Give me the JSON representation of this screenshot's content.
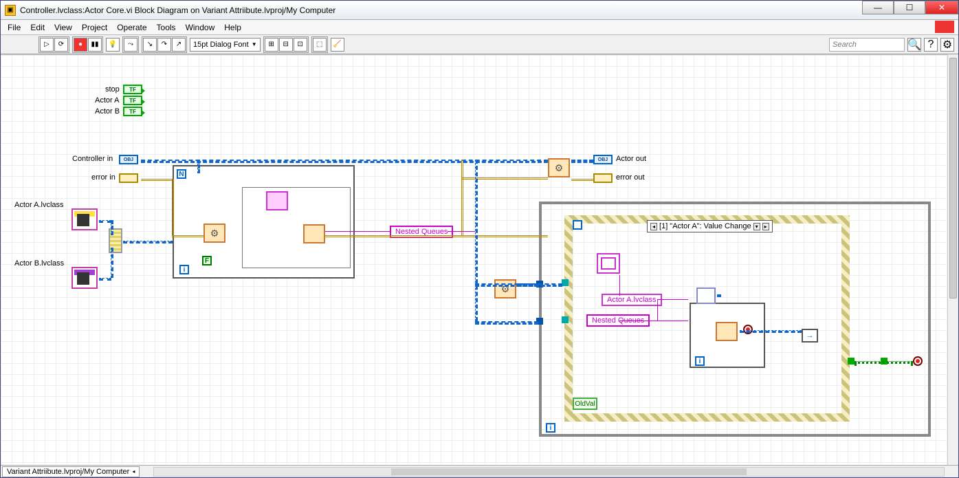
{
  "window": {
    "title": "Controller.lvclass:Actor Core.vi Block Diagram on Variant Attriibute.lvproj/My Computer"
  },
  "menu": [
    "File",
    "Edit",
    "View",
    "Project",
    "Operate",
    "Tools",
    "Window",
    "Help"
  ],
  "toolbar": {
    "font": "15pt Dialog Font",
    "search_placeholder": "Search"
  },
  "diagram": {
    "bool_labels": {
      "stop": "stop",
      "actorA": "Actor A",
      "actorB": "Actor B"
    },
    "bool_value_text": "TF",
    "controller_in": "Controller in",
    "error_in": "error in",
    "actor_out": "Actor out",
    "error_out": "error out",
    "class_a": "Actor A.lvclass",
    "class_b": "Actor B.lvclass",
    "nested_queues": "Nested Queues",
    "obj_text": "OBJ",
    "event_case": "[1] \"Actor A\": Value Change",
    "class_a_const": "Actor A.lvclass",
    "nested_queues2": "Nested Queues",
    "oldval": "OldVal",
    "loop_i": "i",
    "loop_n": "N",
    "false_const": "F"
  },
  "status": {
    "tab": "Variant Attriibute.lvproj/My Computer"
  }
}
